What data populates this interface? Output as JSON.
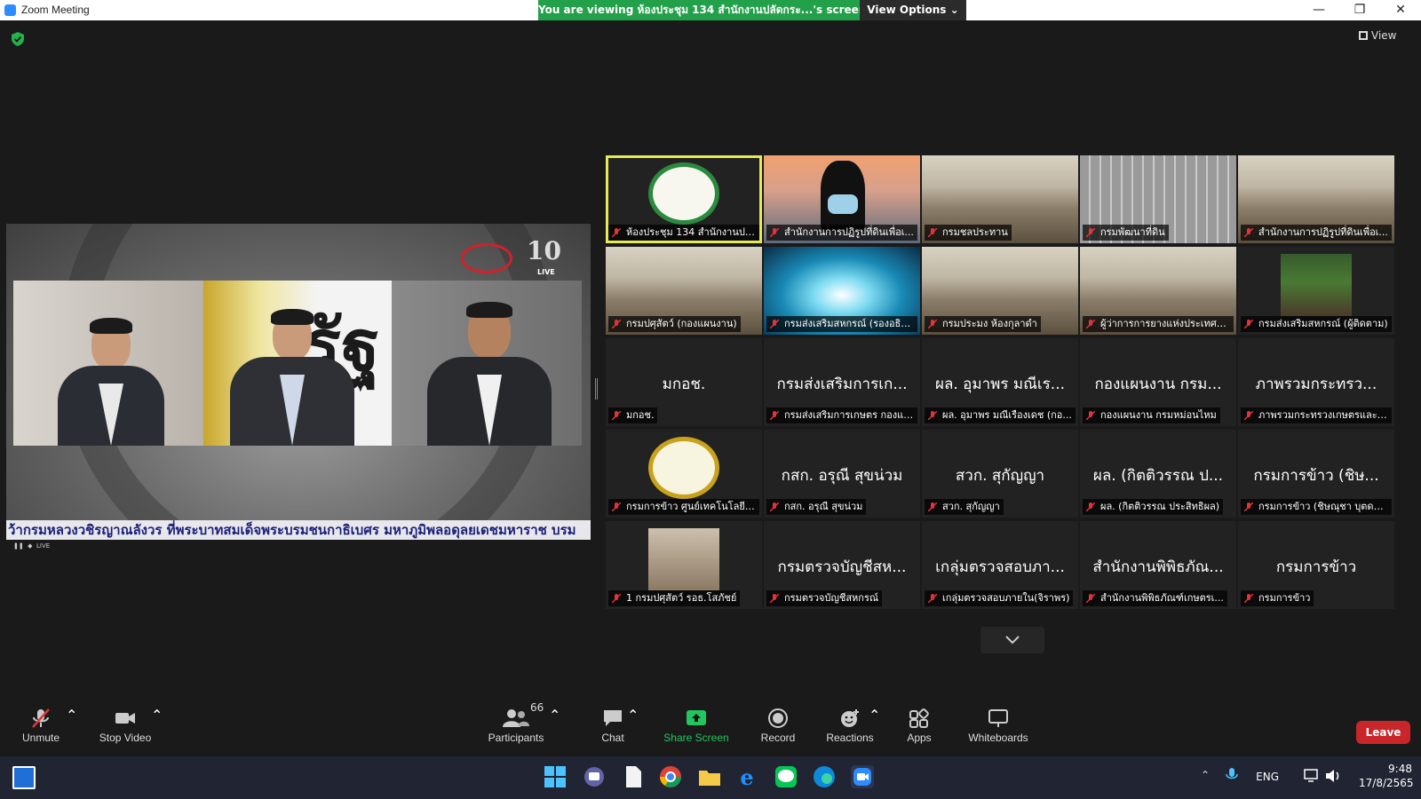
{
  "window": {
    "title": "Zoom Meeting",
    "viewing_banner": "You are viewing ห้องประชุม 134 สำนักงานปลัดกระ...'s screen",
    "view_options": "View Options",
    "view_button": "View"
  },
  "share": {
    "ticker": "ว้ากรมหลวงวชิรญาณลังวร  ที่พระบาทสมเด็จพระบรมชนกาธิเบศร มหาภูมิพลอดุลยเดชมหาราช บรม",
    "logo_text": "10",
    "live_text": "LIVE",
    "live_small": "LIVE",
    "thai_word": "รัฐ"
  },
  "gallery": {
    "tiles": [
      {
        "big": "",
        "caption": "ห้องประชุม 134 สำนักงานปลัดก...",
        "image": "logo"
      },
      {
        "big": "",
        "caption": "สำนักงานการปฏิรูปที่ดินเพื่อเ...",
        "image": "ocean"
      },
      {
        "big": "",
        "caption": "กรมชลประทาน",
        "image": "room"
      },
      {
        "big": "",
        "caption": "กรมพัฒนาที่ดิน",
        "image": "blinds"
      },
      {
        "big": "",
        "caption": "สำนักงานการปฏิรูปที่ดินเพื่อเ...",
        "image": "room"
      },
      {
        "big": "",
        "caption": "กรมปศุสัตว์ (กองแผนงาน)",
        "image": "room"
      },
      {
        "big": "",
        "caption": "กรมส่งเสริมสหกรณ์ (รองอธิบ...",
        "image": "tunnel"
      },
      {
        "big": "",
        "caption": "กรมประมง ห้องกุลาดำ",
        "image": "room"
      },
      {
        "big": "",
        "caption": "ผู้ว่าการการยางแห่งประเทศไท...",
        "image": "room"
      },
      {
        "big": "",
        "caption": "กรมส่งเสริมสหกรณ์ (ผู้ติดตาม)",
        "image": "plant"
      },
      {
        "big": "มกอช.",
        "caption": "มกอช.",
        "image": "none"
      },
      {
        "big": "กรมส่งเสริมการเก...",
        "caption": "กรมส่งเสริมการเกษตร กองแผ...",
        "image": "none"
      },
      {
        "big": "ผล. อุมาพร มณีเร...",
        "caption": "ผล. อุมาพร มณีเรืองเดช (กอ...",
        "image": "none"
      },
      {
        "big": "กองแผนงาน กรม...",
        "caption": "กองแผนงาน กรมหม่อนไหม",
        "image": "none"
      },
      {
        "big": "ภาพรวมกระทรว...",
        "caption": "ภาพรวมกระทรวงเกษตรและส...",
        "image": "none"
      },
      {
        "big": "",
        "caption": "กรมการข้าว ศูนย์เทคโนโลยีส...",
        "image": "rice"
      },
      {
        "big": "กสก. อรุณี สุขน่วม",
        "caption": "กสก. อรุณี สุขน่วม",
        "image": "none"
      },
      {
        "big": "สวก. สุกัญญา",
        "caption": "สวก. สุกัญญา",
        "image": "none"
      },
      {
        "big": "ผล. (กิตติวรรณ ป...",
        "caption": "ผล. (กิตติวรรณ ประสิทธิผล)",
        "image": "none"
      },
      {
        "big": "กรมการข้าว (ชิษ...",
        "caption": "กรมการข้าว (ชิษณุชา บุตดา...",
        "image": "none"
      },
      {
        "big": "",
        "caption": "1 กรมปศุสัตว์ รอธ.โสภัชย์",
        "image": "man"
      },
      {
        "big": "กรมตรวจบัญชีสห...",
        "caption": "กรมตรวจบัญชีสหกรณ์",
        "image": "none"
      },
      {
        "big": "เกลุ่มตรวจสอบภา...",
        "caption": "เกลุ่มตรวจสอบภายใน(จิราพร)",
        "image": "none"
      },
      {
        "big": "สำนักงานพิพิธภัณ...",
        "caption": "สำนักงานพิพิธภัณฑ์เกษตรเ...",
        "image": "none"
      },
      {
        "big": "กรมการข้าว",
        "caption": "กรมการข้าว",
        "image": "none"
      }
    ]
  },
  "toolbar": {
    "unmute": "Unmute",
    "stop_video": "Stop Video",
    "participants": "Participants",
    "participants_count": "66",
    "chat": "Chat",
    "share_screen": "Share Screen",
    "record": "Record",
    "reactions": "Reactions",
    "apps": "Apps",
    "whiteboards": "Whiteboards",
    "leave": "Leave"
  },
  "taskbar": {
    "lang": "ENG",
    "time": "9:48",
    "date": "17/8/2565"
  },
  "colors": {
    "green_banner": "#23a04a",
    "leave_red": "#c9262c",
    "active_tile_border": "#e6ea53"
  }
}
